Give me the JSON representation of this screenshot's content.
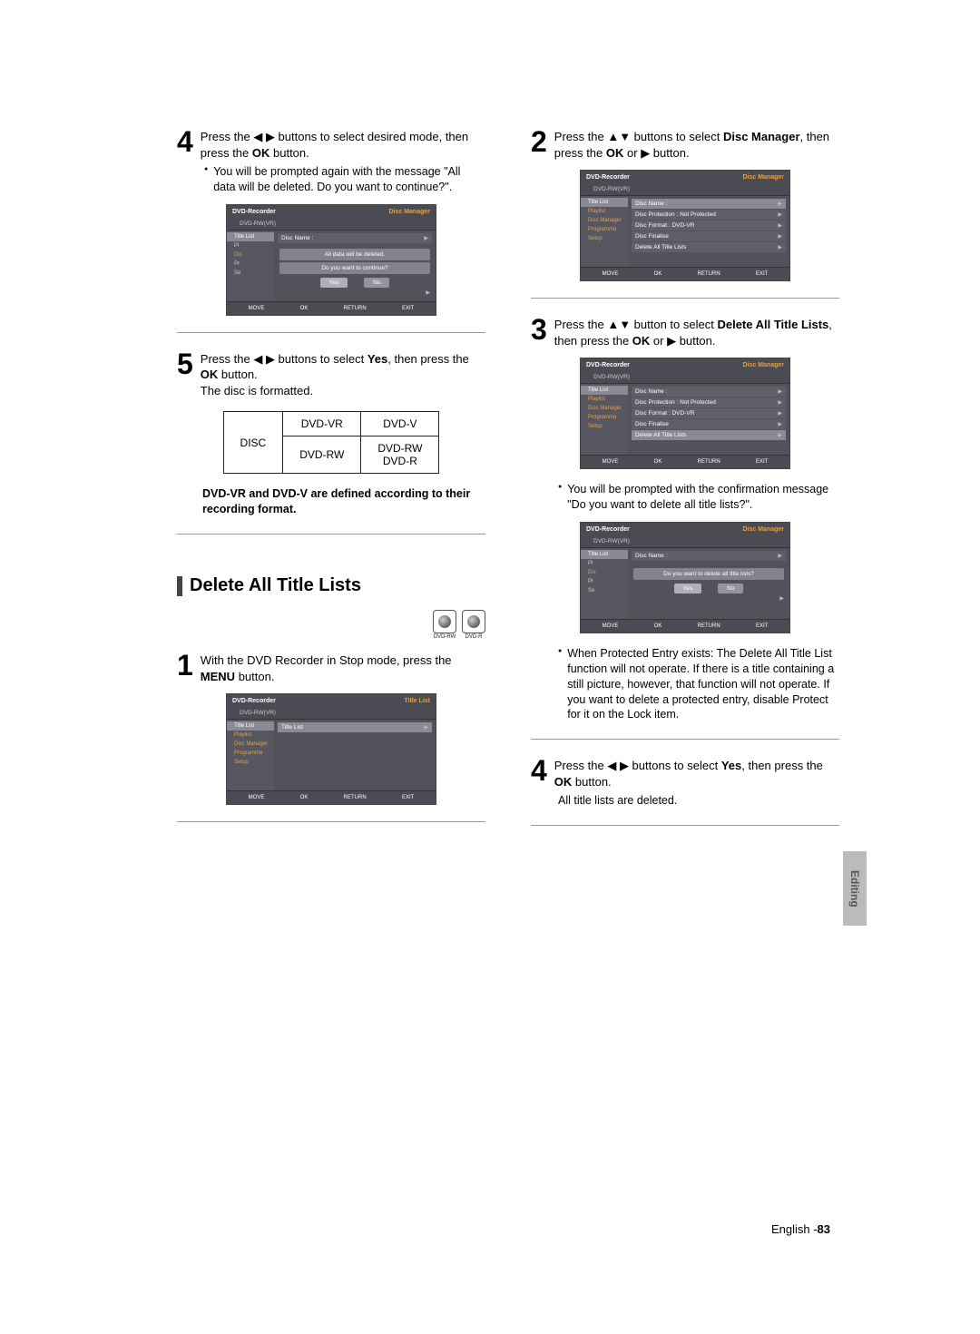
{
  "left": {
    "step4": {
      "pre": "Press the ",
      "btns": "◀ ▶",
      "mid": " buttons to select desired mode, then press the ",
      "ok": "OK",
      "post": " button."
    },
    "step4_bullet": "You will be prompted again with the message \"All data will be deleted. Do you want to continue?\".",
    "step5": {
      "pre": "Press the ",
      "btns": "◀ ▶",
      "mid": " buttons to select ",
      "yes": "Yes",
      "mid2": ", then press the ",
      "ok": "OK",
      "post": " button.",
      "line3": "The disc is formatted."
    },
    "table": {
      "r1c1": "",
      "r1c2": "DVD-VR",
      "r1c3": "DVD-V",
      "r2c1": "DISC",
      "r2c2": "DVD-RW",
      "r2c3a": "DVD-RW",
      "r2c3b": "DVD-R"
    },
    "caption": "DVD-VR and DVD-V are defined according to their recording format.",
    "section": "Delete All Title Lists",
    "badges": {
      "rw": "DVD-RW",
      "r": "DVD-R"
    },
    "step1": {
      "pre": "With the DVD Recorder in Stop mode, press the ",
      "menu": "MENU",
      "post": " button."
    }
  },
  "right": {
    "step2": {
      "pre": "Press the ",
      "btns": "▲▼",
      "mid": " buttons to select ",
      "dm": "Disc Manager",
      "mid2": ", then press the ",
      "ok": "OK",
      "or": " or ",
      "play": "▶",
      "post": " button."
    },
    "step3": {
      "pre": "Press the ",
      "btns": "▲▼",
      "mid": " button to select ",
      "del": "Delete All Title Lists",
      "mid2": ", then press the ",
      "ok": "OK",
      "or": " or ",
      "play": "▶",
      "post": " button."
    },
    "step3_bullet": "You will be prompted with the confirmation message \"Do you want to delete all title lists?\".",
    "step3_bullet2": "When Protected Entry exists: The Delete All Title List function will not operate. If there is a title containing a still picture, however, that function will not operate. If you want to delete a protected entry, disable Protect for it on the Lock item.",
    "step4": {
      "pre": "Press the ",
      "btns": "◀ ▶",
      "mid": " buttons to select ",
      "yes": "Yes",
      "mid2": ", then press the ",
      "ok": "OK",
      "post": " button."
    },
    "step4_sub": "All title lists are deleted."
  },
  "mock": {
    "title": "DVD-Recorder",
    "dmgr": "Disc Manager",
    "tlist": "Title List",
    "sub": "DVD-RW(VR)",
    "side": {
      "title_list": "Title List",
      "playlist": "Playlist",
      "disc_manager": "Disc Manager",
      "programme": "Programme",
      "setup": "Setup",
      "pl": "Pl",
      "dis": "Dis",
      "pr": "Pr",
      "se": "Se"
    },
    "main": {
      "disc_name": "Disc Name  :",
      "disc_prot": "Disc Protection : Not Protected",
      "disc_format": "Disc Format       : DVD-VR",
      "disc_finalise": "Disc Finalise",
      "delete_all": "Delete All Title Lists",
      "title_list": "Title List"
    },
    "prompt1a": "All data will be deleted.",
    "prompt1b": "Do you want to continue?",
    "prompt2": "Do you want to delete all title lists?",
    "yes": "Yes",
    "no": "No",
    "footer": {
      "move": "MOVE",
      "ok": "OK",
      "return": "RETURN",
      "exit": "EXIT"
    }
  },
  "side_tab": "Editing",
  "footer": {
    "lang": "English -",
    "page": "83"
  }
}
